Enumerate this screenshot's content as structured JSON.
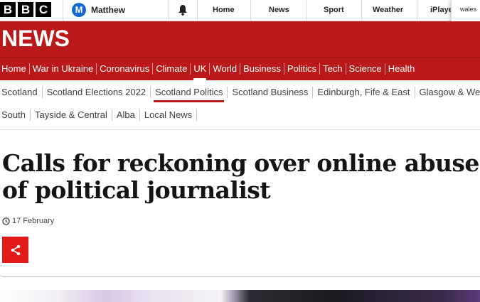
{
  "topbar": {
    "logo_letters": [
      "B",
      "B",
      "C"
    ],
    "account": {
      "initial": "M",
      "name": "Matthew"
    },
    "links": [
      "Home",
      "News",
      "Sport",
      "Weather",
      "iPlayer"
    ],
    "region": "wales"
  },
  "banner": {
    "title": "NEWS",
    "color": "#bb1919"
  },
  "primary_nav": {
    "items": [
      "Home",
      "War in Ukraine",
      "Coronavirus",
      "Climate",
      "UK",
      "World",
      "Business",
      "Politics",
      "Tech",
      "Science",
      "Health"
    ],
    "active": "UK"
  },
  "secondary_nav": {
    "row1": [
      "Scotland",
      "Scotland Elections 2022",
      "Scotland Politics",
      "Scotland Business",
      "Edinburgh, Fife & East",
      "Glasgow & West"
    ],
    "row2": [
      "South",
      "Tayside & Central",
      "Alba",
      "Local News"
    ],
    "active": "Scotland Politics"
  },
  "article": {
    "headline_line1": "Calls for reckoning over online abuse",
    "headline_line2": "of political journalist",
    "date": "17 February",
    "share_color": "#e21a1a"
  }
}
